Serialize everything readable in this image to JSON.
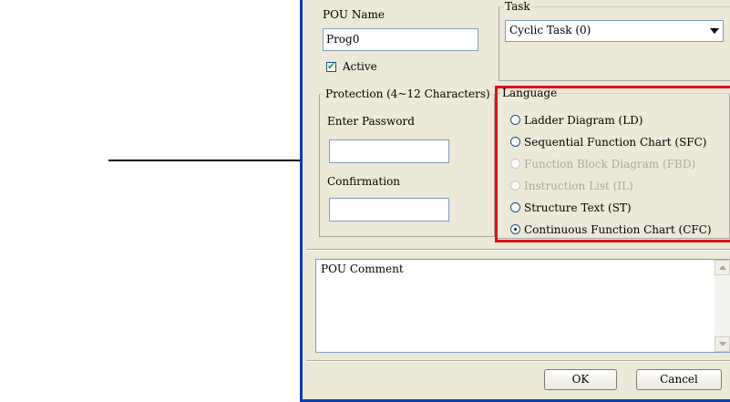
{
  "pou_name": {
    "label": "POU Name",
    "value": "Prog0"
  },
  "active": {
    "label": "Active",
    "checked": true
  },
  "task": {
    "legend": "Task",
    "selected": "Cyclic Task (0)"
  },
  "protection": {
    "legend": "Protection (4~12 Characters)",
    "password_label": "Enter Password",
    "password_value": "",
    "confirm_label": "Confirmation",
    "confirm_value": ""
  },
  "language": {
    "legend": "Language",
    "options": [
      {
        "label": "Ladder Diagram (LD)",
        "enabled": true,
        "selected": false
      },
      {
        "label": "Sequential Function Chart (SFC)",
        "enabled": true,
        "selected": false
      },
      {
        "label": "Function Block Diagram (FBD)",
        "enabled": false,
        "selected": false
      },
      {
        "label": "Instruction List (IL)",
        "enabled": false,
        "selected": false
      },
      {
        "label": "Structure Text (ST)",
        "enabled": true,
        "selected": false
      },
      {
        "label": "Continuous Function Chart (CFC)",
        "enabled": true,
        "selected": true
      }
    ]
  },
  "comment": {
    "value": "POU Comment"
  },
  "buttons": {
    "ok": "OK",
    "cancel": "Cancel"
  },
  "colors": {
    "highlight": "#e0101a",
    "dialog_bg": "#ece9d8",
    "frame": "#0a3db4"
  }
}
